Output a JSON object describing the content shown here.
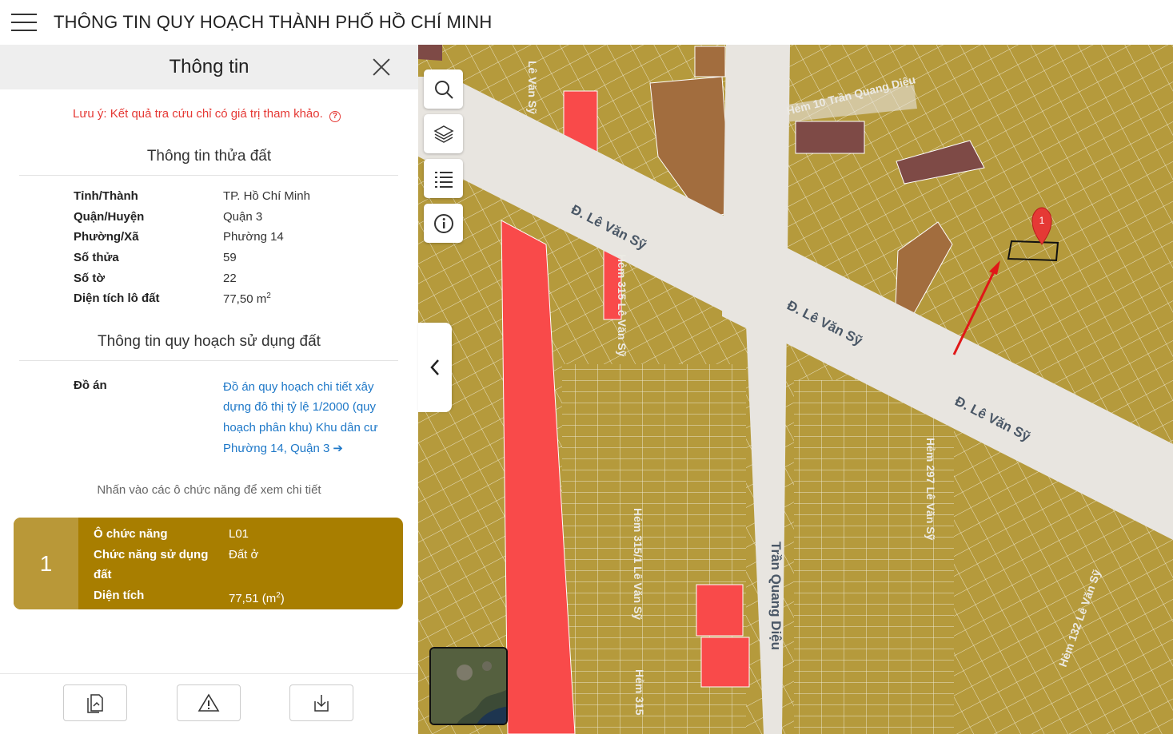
{
  "app": {
    "title": "THÔNG TIN QUY HOẠCH THÀNH PHỐ HỒ CHÍ MINH"
  },
  "panel": {
    "title": "Thông tin",
    "note": "Lưu ý: Kết quả tra cứu chỉ có giá trị tham khảo.",
    "note_icon": "?",
    "parcel_section_title": "Thông tin thửa đất",
    "parcel": [
      {
        "label": "Tỉnh/Thành",
        "value": "TP. Hồ Chí Minh"
      },
      {
        "label": "Quận/Huyện",
        "value": "Quận 3"
      },
      {
        "label": "Phường/Xã",
        "value": "Phường 14"
      },
      {
        "label": "Số thửa",
        "value": "59"
      },
      {
        "label": "Số tờ",
        "value": "22"
      },
      {
        "label": "Diện tích lô đất",
        "value": "77,50 m",
        "sup": "2"
      }
    ],
    "plan_section_title": "Thông tin quy hoạch sử dụng đất",
    "plan_label": "Đồ án",
    "plan_link": "Đồ án quy hoạch chi tiết xây dựng đô thị tỷ lệ 1/2000 (quy hoạch phân khu) Khu dân cư Phường 14, Quận 3",
    "hint": "Nhấn vào các ô chức năng để xem chi tiết"
  },
  "land_card": {
    "number": "1",
    "rows": [
      {
        "label": "Ô chức năng",
        "value": "L01"
      },
      {
        "label": "Chức năng sử dụng đất",
        "value": "Đất ở"
      },
      {
        "label": "Diện tích",
        "value": "77,51 (m",
        "sup": "2",
        "suffix": ")"
      }
    ],
    "color": "#a87e00",
    "number_bg": "#b99838"
  },
  "map": {
    "streets": [
      "Đ. Lê Văn Sỹ",
      "Đ. Lê Văn Sỹ",
      "Đ. Lê Văn Sỹ",
      "Trần Quang Diệu",
      "Hẻm 315 Lê Văn Sỹ",
      "Hẻm 315/1 Lê Văn Sỹ",
      "Hẻm 297 Lê Văn Sỹ",
      "Hẻm 10 Trần Quang Diệu",
      "Hẻm 315",
      "Hẻm 132 Lê Văn Sỹ",
      "Lê Văn Sỹ"
    ],
    "marker_label": "1",
    "colors": {
      "residential": "#b59a3c",
      "public": "#f94a4a",
      "road": "#e8e5e0",
      "commercial": "#a26d3e",
      "institutional": "#7e4a46"
    }
  },
  "icons": {
    "menu": "hamburger-icon",
    "close": "close-icon",
    "search": "search-icon",
    "layers": "layers-icon",
    "list": "list-icon",
    "info": "info-icon",
    "collapse": "chevron-left-icon",
    "document": "document-icon",
    "warning": "warning-icon",
    "download": "download-icon"
  }
}
